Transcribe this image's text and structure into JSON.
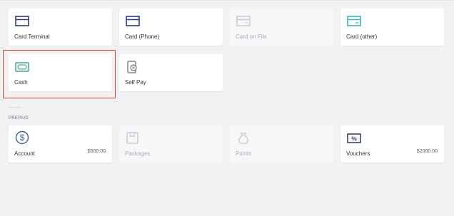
{
  "payment_methods": [
    {
      "label": "Card Terminal",
      "icon": "card-icon",
      "enabled": true
    },
    {
      "label": "Card (Phone)",
      "icon": "card-icon",
      "enabled": true
    },
    {
      "label": "Card on File",
      "icon": "card-icon",
      "enabled": false
    },
    {
      "label": "Card (other)",
      "icon": "card-icon",
      "enabled": true
    },
    {
      "label": "Cash",
      "icon": "cash-icon",
      "enabled": true,
      "selected": true
    },
    {
      "label": "Self Pay",
      "icon": "self-pay-icon",
      "enabled": true
    }
  ],
  "prepaid": {
    "section_label": "PREPAID",
    "items": [
      {
        "label": "Account",
        "amount": "$500.00",
        "icon": "dollar-icon",
        "enabled": true
      },
      {
        "label": "Packages",
        "icon": "package-icon",
        "enabled": false
      },
      {
        "label": "Points",
        "icon": "points-bag-icon",
        "enabled": false
      },
      {
        "label": "Vouchers",
        "amount": "$2000.00",
        "icon": "voucher-percent-icon",
        "enabled": true
      }
    ]
  },
  "colors": {
    "card_blue": "#2b3a8f",
    "card_teal": "#3cb4c9",
    "cash_green": "#3fae7a",
    "selected_outline": "#d9432e",
    "dollar_blue": "#4b62a8",
    "voucher_navy": "#2b3a6f",
    "disabled": "#c6c9ce"
  }
}
